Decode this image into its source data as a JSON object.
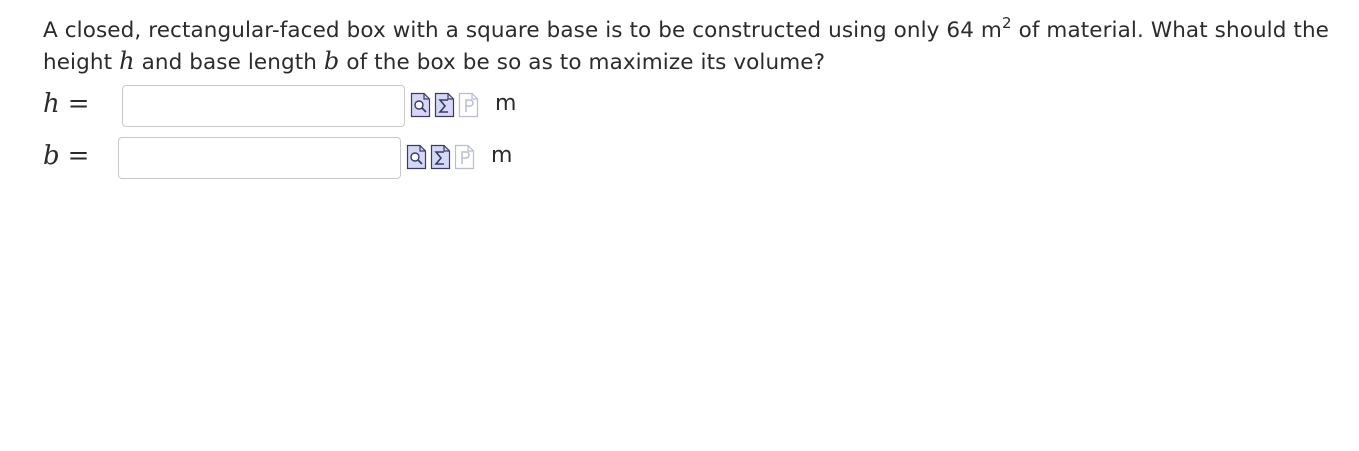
{
  "question": {
    "part1": "A closed, rectangular-faced box with a square base is to be constructed using only 64 m",
    "sup": "2",
    "part2": " of material. What should the height ",
    "var_h": "h",
    "part3": " and base length ",
    "var_b": "b",
    "part4": " of the box be so as to maximize its volume?"
  },
  "answers": {
    "height": {
      "var": "h",
      "eq": "=",
      "value": "",
      "unit": "m"
    },
    "base": {
      "var": "b",
      "eq": "=",
      "value": "",
      "unit": "m"
    }
  },
  "icons": {
    "preview": "preview-icon",
    "equation_editor": "equation-editor-icon",
    "help": "help-icon"
  },
  "colors": {
    "text": "#2b2b2b",
    "input_border": "#c8c8c8",
    "icon_fill": "#d4d8f5",
    "icon_stroke": "#3a3a6a",
    "icon_disabled": "#b9bcd6"
  }
}
